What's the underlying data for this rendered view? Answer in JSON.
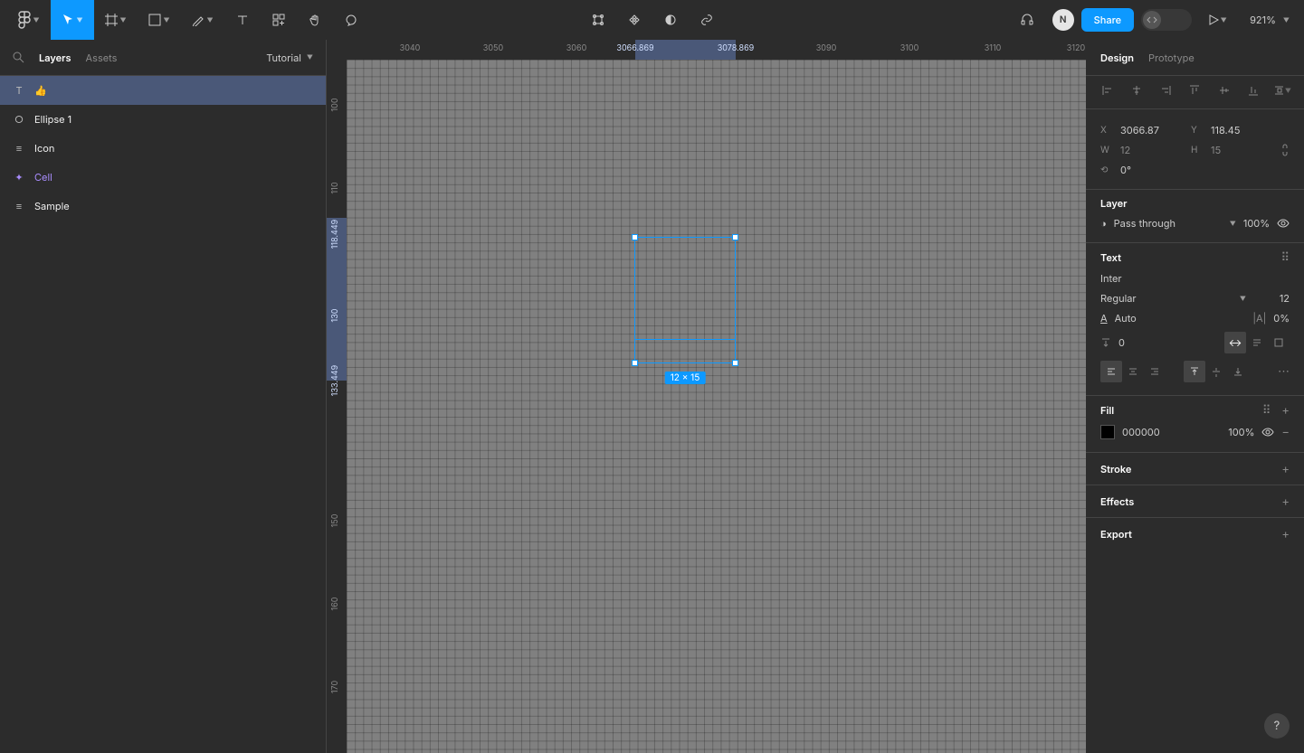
{
  "toolbar": {
    "share": "Share",
    "zoom": "921%",
    "avatar_initial": "N"
  },
  "left_panel": {
    "tabs": {
      "layers": "Layers",
      "assets": "Assets"
    },
    "page": "Tutorial",
    "layers": [
      {
        "icon": "T",
        "label": "👍",
        "selected": true
      },
      {
        "icon": "○",
        "label": "Ellipse 1"
      },
      {
        "icon": "≡",
        "label": "Icon"
      },
      {
        "icon": "✦",
        "label": "Cell",
        "component": true
      },
      {
        "icon": "≡",
        "label": "Sample"
      }
    ]
  },
  "canvas": {
    "ruler_h": [
      "3040",
      "3050",
      "3060",
      "3090",
      "3100",
      "3110",
      "3120"
    ],
    "ruler_h_sel": {
      "start": "3066.869",
      "end": "3078.869"
    },
    "ruler_v": [
      "100",
      "110",
      "150",
      "160",
      "170"
    ],
    "ruler_v_sel": {
      "start": "118.449",
      "mid": "130",
      "end": "133.449"
    },
    "size_label": "12 × 15"
  },
  "right_panel": {
    "tabs": {
      "design": "Design",
      "prototype": "Prototype"
    },
    "transform": {
      "x_label": "X",
      "x": "3066.87",
      "y_label": "Y",
      "y": "118.45",
      "w_label": "W",
      "w": "12",
      "h_label": "H",
      "h": "15",
      "rotation": "0°"
    },
    "layer": {
      "title": "Layer",
      "blend": "Pass through",
      "opacity": "100%"
    },
    "text": {
      "title": "Text",
      "font": "Inter",
      "weight": "Regular",
      "size": "12",
      "line_height_label": "Auto",
      "letter_spacing": "0%",
      "paragraph_spacing": "0"
    },
    "fill": {
      "title": "Fill",
      "hex": "000000",
      "opacity": "100%",
      "swatch": "#000000"
    },
    "stroke": {
      "title": "Stroke"
    },
    "effects": {
      "title": "Effects"
    },
    "export": {
      "title": "Export"
    }
  }
}
